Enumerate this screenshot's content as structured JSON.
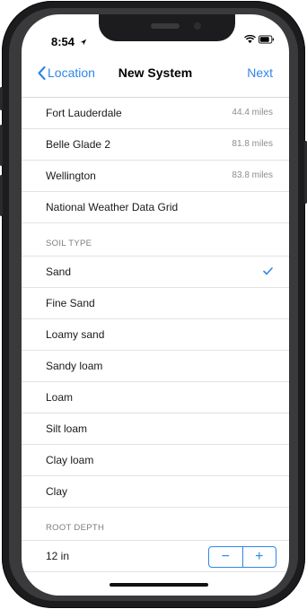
{
  "status_bar": {
    "time": "8:54"
  },
  "nav": {
    "back_label": "Location",
    "title": "New System",
    "next_label": "Next"
  },
  "stations": [
    {
      "name": "Fort Lauderdale",
      "distance": "44.4 miles"
    },
    {
      "name": "Belle Glade 2",
      "distance": "81.8 miles"
    },
    {
      "name": "Wellington",
      "distance": "83.8 miles"
    }
  ],
  "grid_option": {
    "label": "National Weather Data Grid"
  },
  "soil": {
    "header": "SOIL TYPE",
    "options": [
      "Sand",
      "Fine Sand",
      "Loamy sand",
      "Sandy loam",
      "Loam",
      "Silt loam",
      "Clay loam",
      "Clay"
    ],
    "selected": "Sand"
  },
  "root_depth": {
    "header": "ROOT DEPTH",
    "value": "12 in",
    "decrement_label": "−",
    "increment_label": "+"
  },
  "colors": {
    "accent": "#2f86e8",
    "separator": "#e2e2e6",
    "frame": "#1c1c1e"
  },
  "icons": [
    "location-arrow-icon",
    "wifi-icon",
    "battery-icon",
    "chevron-left-icon",
    "checkmark-icon"
  ]
}
